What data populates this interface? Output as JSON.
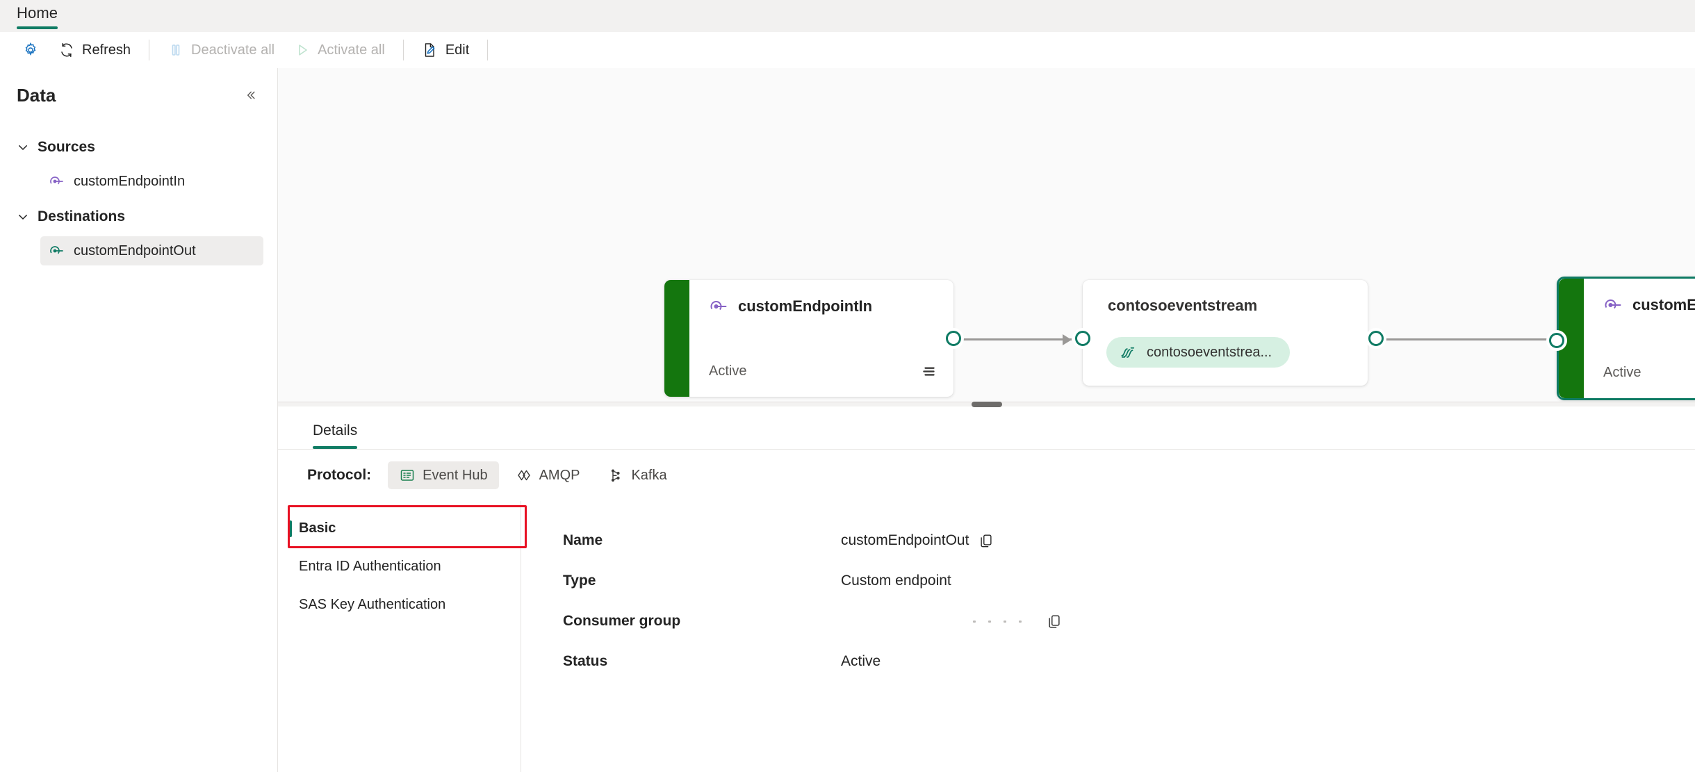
{
  "ribbon": {
    "tabs": [
      {
        "label": "Home"
      }
    ]
  },
  "toolbar": {
    "settings_icon": "gear-icon",
    "refresh_label": "Refresh",
    "deactivate_label": "Deactivate all",
    "activate_label": "Activate all",
    "edit_label": "Edit"
  },
  "sidebar": {
    "title": "Data",
    "collapse_icon": "chevron-double-left-icon",
    "groups": [
      {
        "label": "Sources",
        "items": [
          {
            "label": "customEndpointIn",
            "selected": false
          }
        ]
      },
      {
        "label": "Destinations",
        "items": [
          {
            "label": "customEndpointOut",
            "selected": true
          }
        ]
      }
    ]
  },
  "canvas": {
    "nodes": [
      {
        "id": "source",
        "title": "customEndpointIn",
        "status": "Active",
        "selected": false
      },
      {
        "id": "stream",
        "title": "contosoeventstream",
        "pill_label": "contosoeventstrea..."
      },
      {
        "id": "dest",
        "title": "customEndpointOut",
        "status": "Active",
        "selected": true
      }
    ]
  },
  "details": {
    "tabs": [
      {
        "label": "Details",
        "active": true
      }
    ],
    "protocol_label": "Protocol:",
    "protocols": [
      {
        "label": "Event Hub",
        "icon": "event-hub-icon",
        "active": true
      },
      {
        "label": "AMQP",
        "icon": "amqp-icon",
        "active": false
      },
      {
        "label": "Kafka",
        "icon": "kafka-icon",
        "active": false
      }
    ],
    "subnav": [
      {
        "label": "Basic",
        "active": true
      },
      {
        "label": "Entra ID Authentication",
        "active": false
      },
      {
        "label": "SAS Key Authentication",
        "active": false
      }
    ],
    "fields": [
      {
        "label": "Name",
        "value": "customEndpointOut",
        "copy": true,
        "masked": false
      },
      {
        "label": "Type",
        "value": "Custom endpoint",
        "copy": false,
        "masked": false
      },
      {
        "label": "Consumer group",
        "value": "",
        "copy": true,
        "masked": true
      },
      {
        "label": "Status",
        "value": "Active",
        "copy": false,
        "masked": false
      }
    ]
  },
  "colors": {
    "accent_teal": "#107c64",
    "node_green": "#14760e",
    "annotation_red": "#e81123",
    "endpoint_purple": "#8661c5"
  }
}
